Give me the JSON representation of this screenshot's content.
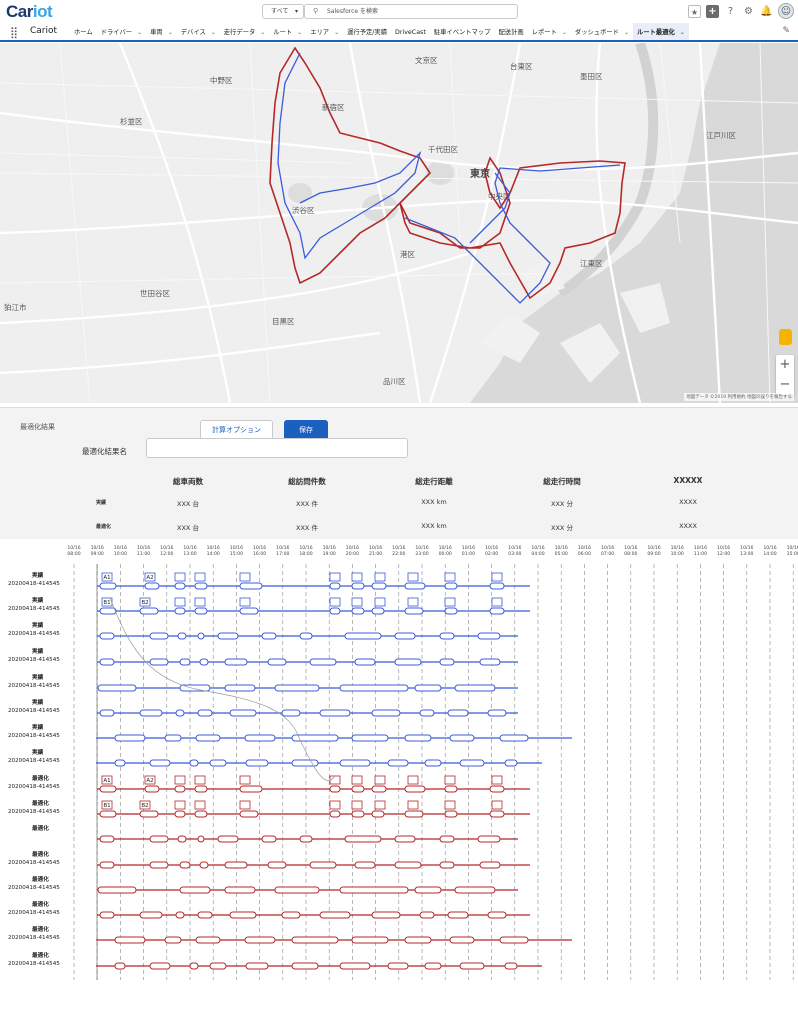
{
  "header": {
    "logo_main": "Car",
    "logo_accent": "iot",
    "search_scope": "すべて",
    "search_placeholder": "Salesforce を検索"
  },
  "nav": {
    "app_name": "Cariot",
    "tabs": [
      {
        "label": "ホーム",
        "has_menu": false,
        "active": false
      },
      {
        "label": "ドライバー",
        "has_menu": true,
        "active": false
      },
      {
        "label": "車両",
        "has_menu": true,
        "active": false
      },
      {
        "label": "デバイス",
        "has_menu": true,
        "active": false
      },
      {
        "label": "走行データ",
        "has_menu": true,
        "active": false
      },
      {
        "label": "ルート",
        "has_menu": true,
        "active": false
      },
      {
        "label": "エリア",
        "has_menu": true,
        "active": false
      },
      {
        "label": "運行予定/実績",
        "has_menu": false,
        "active": false
      },
      {
        "label": "DriveCast",
        "has_menu": false,
        "active": false
      },
      {
        "label": "駐車イベントマップ",
        "has_menu": false,
        "active": false
      },
      {
        "label": "配送計画",
        "has_menu": false,
        "active": false
      },
      {
        "label": "レポート",
        "has_menu": true,
        "active": false
      },
      {
        "label": "ダッシュボード",
        "has_menu": true,
        "active": false
      },
      {
        "label": "ルート最適化",
        "has_menu": true,
        "active": true
      }
    ]
  },
  "map": {
    "labels": [
      "文京区",
      "台東区",
      "墨田区",
      "中野区",
      "杉並区",
      "新宿区",
      "千代田区",
      "江戸川区",
      "渋谷区",
      "東京",
      "中央区",
      "港区",
      "江東区",
      "世田谷区",
      "狛江市",
      "目黒区",
      "品川区"
    ],
    "attribution": "地図データ ©2019  利用規約  地図の誤りを報告する",
    "route_colors": {
      "actual": "#3b5bdb",
      "optimized": "#b52828"
    }
  },
  "result": {
    "section_title": "最適化結果",
    "name_label": "最適化結果名",
    "name_value": "",
    "options_button": "計算オプション",
    "save_button": "保存",
    "columns": [
      "総車両数",
      "総訪問件数",
      "総走行距離",
      "総走行時間",
      "XXXXX"
    ],
    "rows": [
      {
        "label": "実績",
        "values": [
          "XXX 台",
          "XXX 件",
          "XXX km",
          "XXX 分",
          "XXXX"
        ]
      },
      {
        "label": "最適化",
        "values": [
          "XXX 台",
          "XXX 件",
          "XXX km",
          "XXX 分",
          "XXXX"
        ]
      }
    ]
  },
  "timeline": {
    "date": "10/16",
    "times": [
      "08:00",
      "09:00",
      "10:00",
      "11:00",
      "12:00",
      "13:00",
      "14:00",
      "15:00",
      "16:00",
      "17:00",
      "18:00",
      "19:00",
      "20:00",
      "21:00",
      "22:00",
      "23:00",
      "00:00",
      "01:00",
      "02:00",
      "03:00",
      "04:00",
      "05:00",
      "06:00",
      "07:00",
      "08:00",
      "09:00",
      "10:00",
      "11:00",
      "12:00",
      "13:00",
      "14:00",
      "15:00"
    ],
    "rows": [
      {
        "kind": "実績",
        "id": "20200418-414545",
        "color": "#3b5bdb"
      },
      {
        "kind": "実績",
        "id": "20200418-414545",
        "color": "#3b5bdb"
      },
      {
        "kind": "実績",
        "id": "20200418-414545",
        "color": "#3b5bdb"
      },
      {
        "kind": "実績",
        "id": "20200418-414545",
        "color": "#3b5bdb"
      },
      {
        "kind": "実績",
        "id": "20200418-414545",
        "color": "#3b5bdb"
      },
      {
        "kind": "実績",
        "id": "20200418-414545",
        "color": "#3b5bdb"
      },
      {
        "kind": "実績",
        "id": "20200418-414545",
        "color": "#3b5bdb"
      },
      {
        "kind": "実績",
        "id": "20200418-414545",
        "color": "#3b5bdb"
      },
      {
        "kind": "最適化",
        "id": "20200418-414545",
        "color": "#b52828"
      },
      {
        "kind": "最適化",
        "id": "20200418-414545",
        "color": "#b52828"
      },
      {
        "kind": "最適化",
        "id": "",
        "color": "#b52828"
      },
      {
        "kind": "最適化",
        "id": "20200418-414545",
        "color": "#b52828"
      },
      {
        "kind": "最適化",
        "id": "20200418-414545",
        "color": "#b52828"
      },
      {
        "kind": "最適化",
        "id": "20200418-414545",
        "color": "#b52828"
      },
      {
        "kind": "最適化",
        "id": "20200418-414545",
        "color": "#b52828"
      },
      {
        "kind": "最適化",
        "id": "20200418-414545",
        "color": "#b52828"
      }
    ],
    "stop_tags": [
      "A1",
      "A2",
      "B1",
      "B2",
      "A1",
      "A2",
      "B1",
      "B2"
    ]
  }
}
